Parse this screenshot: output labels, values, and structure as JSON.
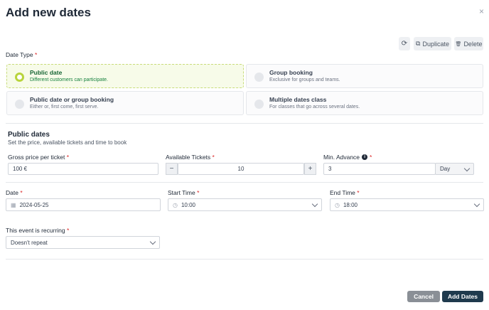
{
  "header": {
    "title": "Add new dates",
    "close_icon": "×"
  },
  "toolbar": {
    "refresh_icon": "⟳",
    "duplicate_icon": "⧉",
    "duplicate_label": "Duplicate",
    "delete_icon": "🗑",
    "delete_label": "Delete"
  },
  "date_type": {
    "label": "Date Type",
    "required": "*",
    "options": [
      {
        "title": "Public date",
        "subtitle": "Different customers can participate.",
        "selected": true
      },
      {
        "title": "Group booking",
        "subtitle": "Exclusive for groups and teams.",
        "selected": false
      },
      {
        "title": "Public date or group booking",
        "subtitle": "Either or, first come, first serve.",
        "selected": false
      },
      {
        "title": "Multiple dates class",
        "subtitle": "For classes that go across several dates.",
        "selected": false
      }
    ]
  },
  "section": {
    "title": "Public dates",
    "subtitle": "Set the price, available tickets and time to book"
  },
  "price": {
    "label": "Gross price per ticket",
    "required": "*",
    "value": "100 €"
  },
  "tickets": {
    "label": "Available Tickets",
    "required": "*",
    "minus": "−",
    "plus": "+",
    "value": "10"
  },
  "advance": {
    "label": "Min. Advance",
    "info_icon": "i",
    "required": "*",
    "value": "3",
    "unit": "Day"
  },
  "date": {
    "label": "Date",
    "required": "*",
    "calendar_icon": "▦",
    "value": "2024-05-25"
  },
  "start_time": {
    "label": "Start Time",
    "required": "*",
    "clock_icon": "◷",
    "value": "10:00"
  },
  "end_time": {
    "label": "End Time",
    "required": "*",
    "clock_icon": "◷",
    "value": "18:00"
  },
  "recurring": {
    "label": "This event is recurring",
    "required": "*",
    "value": "Doesn't repeat"
  },
  "footer": {
    "cancel_label": "Cancel",
    "add_label": "Add Dates"
  },
  "colors": {
    "primary_button": "#1f3a4d",
    "cancel_button": "#8a8f96",
    "selected_option_bg": "#f7fbe9",
    "selected_radio": "#b8d43c",
    "required": "#dc2626"
  }
}
